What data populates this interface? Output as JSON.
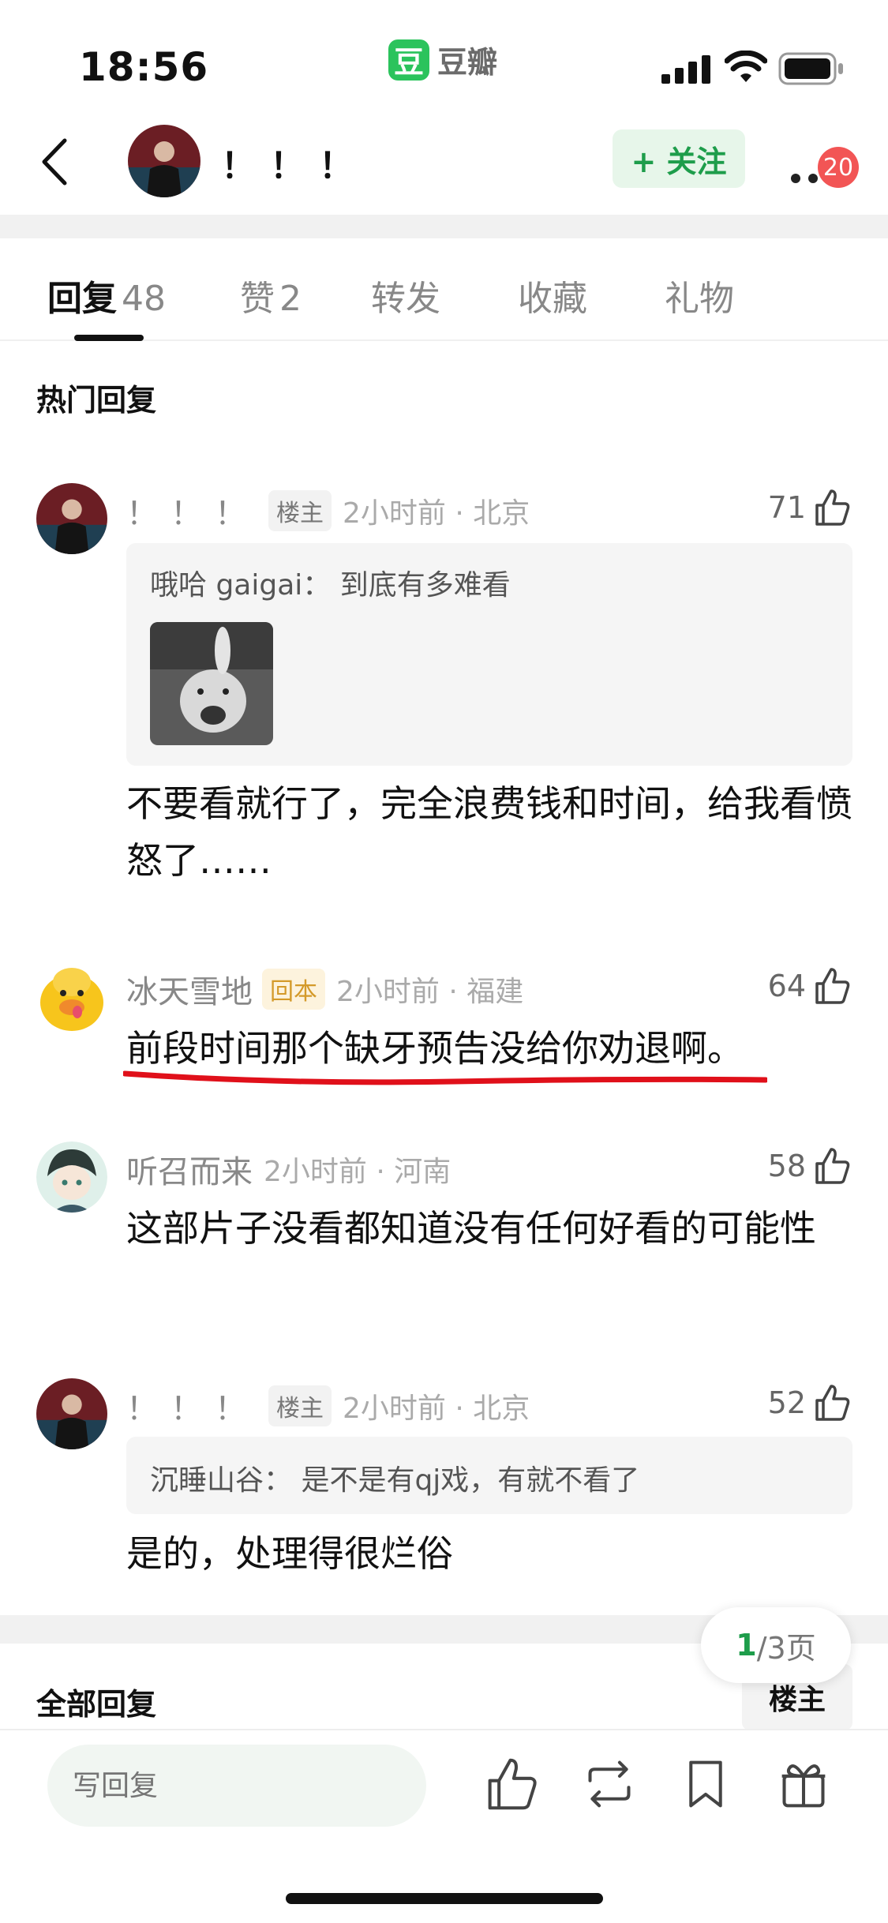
{
  "status_bar": {
    "time": "18:56",
    "app_icon_label": "豆",
    "app_name": "豆瓣"
  },
  "header": {
    "author_name": "！！！",
    "follow_label": "+ 关注",
    "notification_count": "20"
  },
  "tabs": [
    {
      "label": "回复",
      "count": "48"
    },
    {
      "label": "赞",
      "count": "2"
    },
    {
      "label": "转发",
      "count": ""
    },
    {
      "label": "收藏",
      "count": ""
    },
    {
      "label": "礼物",
      "count": ""
    }
  ],
  "hot_replies_title": "热门回复",
  "comments": [
    {
      "user": "！！！",
      "tag": "楼主",
      "meta": "2小时前 · 北京",
      "likes": "71",
      "quote": "哦哈 gaigai： 到底有多难看",
      "body": "不要看就行了，完全浪费钱和时间，给我看愤怒了……"
    },
    {
      "user": "冰天雪地",
      "tag": "回本",
      "meta": "2小时前 · 福建",
      "likes": "64",
      "body": "前段时间那个缺牙预告没给你劝退啊。"
    },
    {
      "user": "听召而来",
      "meta": "2小时前 · 河南",
      "likes": "58",
      "body": "这部片子没看都知道没有任何好看的可能性"
    },
    {
      "user": "！！！",
      "tag": "楼主",
      "meta": "2小时前 · 北京",
      "likes": "52",
      "quote": "沉睡山谷： 是不是有qj戏，有就不看了",
      "body": "是的，处理得很烂俗"
    }
  ],
  "pagination": {
    "current": "1",
    "total": "/3页"
  },
  "all_replies_title": "全部回复",
  "op_filter_label": "楼主",
  "bottom_bar": {
    "reply_placeholder": "写回复"
  },
  "icons": [
    "back-icon",
    "more-icon",
    "thumb-up-icon",
    "repost-icon",
    "bookmark-icon",
    "gift-icon"
  ],
  "colors": {
    "accent_green": "#1e9d4b",
    "follow_bg": "#e7f6ea",
    "badge_red": "#f25555",
    "underline_red": "#e0101a"
  }
}
